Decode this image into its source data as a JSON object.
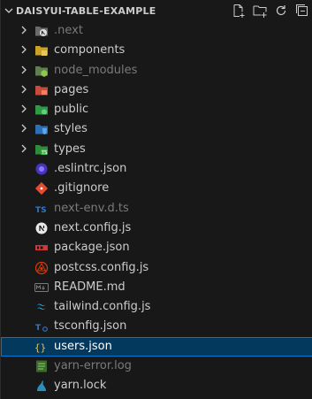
{
  "explorer": {
    "title": "DAISYUI-TABLE-EXAMPLE",
    "actions": [
      "new-file-icon",
      "new-folder-icon",
      "refresh-icon",
      "collapse-all-icon"
    ],
    "items": [
      {
        "label": ".next",
        "type": "folder",
        "icon": "next-folder-icon",
        "dim": true
      },
      {
        "label": "components",
        "type": "folder",
        "icon": "components-folder-icon",
        "dim": false
      },
      {
        "label": "node_modules",
        "type": "folder",
        "icon": "node-modules-folder-icon",
        "dim": true
      },
      {
        "label": "pages",
        "type": "folder",
        "icon": "pages-folder-icon",
        "dim": false
      },
      {
        "label": "public",
        "type": "folder",
        "icon": "public-folder-icon",
        "dim": false
      },
      {
        "label": "styles",
        "type": "folder",
        "icon": "styles-folder-icon",
        "dim": false
      },
      {
        "label": "types",
        "type": "folder",
        "icon": "types-folder-icon",
        "dim": false
      },
      {
        "label": ".eslintrc.json",
        "type": "file",
        "icon": "eslint-icon",
        "dim": false
      },
      {
        "label": ".gitignore",
        "type": "file",
        "icon": "git-icon",
        "dim": false
      },
      {
        "label": "next-env.d.ts",
        "type": "file",
        "icon": "typescript-icon",
        "dim": true
      },
      {
        "label": "next.config.js",
        "type": "file",
        "icon": "nextjs-icon",
        "dim": false
      },
      {
        "label": "package.json",
        "type": "file",
        "icon": "npm-icon",
        "dim": false
      },
      {
        "label": "postcss.config.js",
        "type": "file",
        "icon": "postcss-icon",
        "dim": false
      },
      {
        "label": "README.md",
        "type": "file",
        "icon": "markdown-icon",
        "dim": false
      },
      {
        "label": "tailwind.config.js",
        "type": "file",
        "icon": "tailwind-icon",
        "dim": false
      },
      {
        "label": "tsconfig.json",
        "type": "file",
        "icon": "tsconfig-icon",
        "dim": false
      },
      {
        "label": "users.json",
        "type": "file",
        "icon": "json-icon",
        "dim": false,
        "selected": true
      },
      {
        "label": "yarn-error.log",
        "type": "file",
        "icon": "log-icon",
        "dim": true
      },
      {
        "label": "yarn.lock",
        "type": "file",
        "icon": "yarn-icon",
        "dim": false
      }
    ]
  },
  "colors": {
    "background": "#181818",
    "text": "#cccccc",
    "dim_text": "#7a7a7a",
    "selection": "#04395e",
    "selection_border": "#0078d4"
  }
}
